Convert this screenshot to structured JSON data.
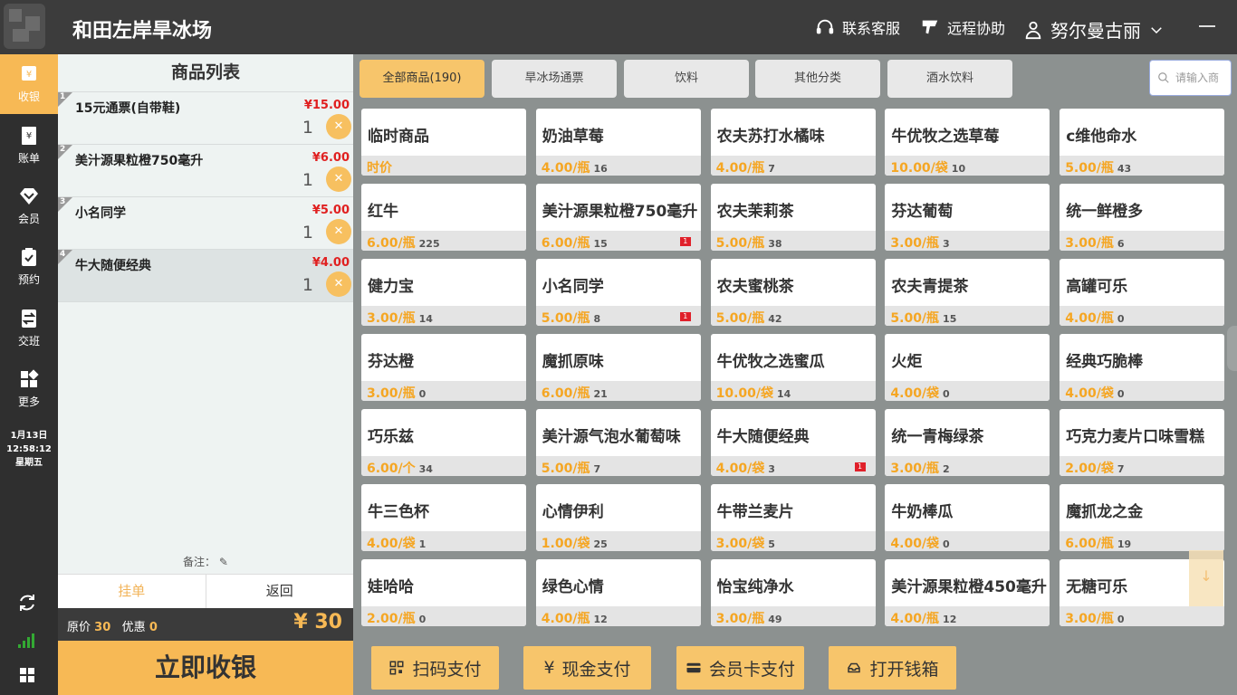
{
  "header": {
    "store_name": "和田左岸旱冰场",
    "support": "联系客服",
    "remote": "远程协助",
    "user": "努尔曼古丽"
  },
  "sidebar": {
    "items": [
      {
        "label": "收银",
        "icon": "cashier-icon"
      },
      {
        "label": "账单",
        "icon": "bill-icon"
      },
      {
        "label": "会员",
        "icon": "member-icon"
      },
      {
        "label": "预约",
        "icon": "reservation-icon"
      },
      {
        "label": "交班",
        "icon": "shift-icon"
      },
      {
        "label": "更多",
        "icon": "more-icon"
      }
    ],
    "date": "1月13日",
    "time": "12:58:12",
    "weekday": "星期五"
  },
  "cart": {
    "title": "商品列表",
    "items": [
      {
        "index": "1",
        "name": "15元通票(自带鞋)",
        "price": "¥15.00",
        "qty": "1"
      },
      {
        "index": "2",
        "name": "美汁源果粒橙750毫升",
        "price": "¥6.00",
        "qty": "1"
      },
      {
        "index": "3",
        "name": "小名同学",
        "price": "¥5.00",
        "qty": "1"
      },
      {
        "index": "4",
        "name": "牛大随便经典",
        "price": "¥4.00",
        "qty": "1"
      }
    ],
    "remark_label": "备注：",
    "hang_label": "挂单",
    "back_label": "返回",
    "orig_label": "原价",
    "orig_value": "30",
    "discount_label": "优惠",
    "discount_value": "0",
    "total": "¥ 30",
    "checkout_label": "立即收银"
  },
  "tabs": [
    {
      "label": "全部商品(190)",
      "active": true
    },
    {
      "label": "旱冰场通票",
      "active": false
    },
    {
      "label": "饮料",
      "active": false
    },
    {
      "label": "其他分类",
      "active": false
    },
    {
      "label": "酒水饮料",
      "active": false
    }
  ],
  "search": {
    "placeholder": "请输入商"
  },
  "products": [
    {
      "name": "临时商品",
      "price": "时价",
      "stock": "",
      "badge": ""
    },
    {
      "name": "奶油草莓",
      "price": "4.00/瓶",
      "stock": "16",
      "badge": ""
    },
    {
      "name": "农夫苏打水橘味",
      "price": "4.00/瓶",
      "stock": "7",
      "badge": ""
    },
    {
      "name": "牛优牧之选草莓",
      "price": "10.00/袋",
      "stock": "10",
      "badge": ""
    },
    {
      "name": "c维他命水",
      "price": "5.00/瓶",
      "stock": "43",
      "badge": ""
    },
    {
      "name": "红牛",
      "price": "6.00/瓶",
      "stock": "225",
      "badge": ""
    },
    {
      "name": "美汁源果粒橙750毫升",
      "price": "6.00/瓶",
      "stock": "15",
      "badge": "1"
    },
    {
      "name": "农夫茉莉茶",
      "price": "5.00/瓶",
      "stock": "38",
      "badge": ""
    },
    {
      "name": "芬达葡萄",
      "price": "3.00/瓶",
      "stock": "3",
      "badge": ""
    },
    {
      "name": "统一鲜橙多",
      "price": "3.00/瓶",
      "stock": "6",
      "badge": ""
    },
    {
      "name": "健力宝",
      "price": "3.00/瓶",
      "stock": "14",
      "badge": ""
    },
    {
      "name": "小名同学",
      "price": "5.00/瓶",
      "stock": "8",
      "badge": "1"
    },
    {
      "name": "农夫蜜桃茶",
      "price": "5.00/瓶",
      "stock": "42",
      "badge": ""
    },
    {
      "name": "农夫青提茶",
      "price": "5.00/瓶",
      "stock": "15",
      "badge": ""
    },
    {
      "name": "高罐可乐",
      "price": "4.00/瓶",
      "stock": "0",
      "badge": ""
    },
    {
      "name": "芬达橙",
      "price": "3.00/瓶",
      "stock": "0",
      "badge": ""
    },
    {
      "name": "魔抓原味",
      "price": "6.00/瓶",
      "stock": "21",
      "badge": ""
    },
    {
      "name": "牛优牧之选蜜瓜",
      "price": "10.00/袋",
      "stock": "14",
      "badge": ""
    },
    {
      "name": "火炬",
      "price": "4.00/袋",
      "stock": "0",
      "badge": ""
    },
    {
      "name": "经典巧脆棒",
      "price": "4.00/袋",
      "stock": "0",
      "badge": ""
    },
    {
      "name": "巧乐兹",
      "price": "6.00/个",
      "stock": "34",
      "badge": ""
    },
    {
      "name": "美汁源气泡水葡萄味",
      "price": "5.00/瓶",
      "stock": "7",
      "badge": ""
    },
    {
      "name": "牛大随便经典",
      "price": "4.00/袋",
      "stock": "3",
      "badge": "1"
    },
    {
      "name": "统一青梅绿茶",
      "price": "3.00/瓶",
      "stock": "2",
      "badge": ""
    },
    {
      "name": "巧克力麦片口味雪糕",
      "price": "2.00/袋",
      "stock": "7",
      "badge": ""
    },
    {
      "name": "牛三色杯",
      "price": "4.00/袋",
      "stock": "1",
      "badge": ""
    },
    {
      "name": "心情伊利",
      "price": "1.00/袋",
      "stock": "25",
      "badge": ""
    },
    {
      "name": "牛带兰麦片",
      "price": "3.00/袋",
      "stock": "5",
      "badge": ""
    },
    {
      "name": "牛奶棒瓜",
      "price": "4.00/袋",
      "stock": "0",
      "badge": ""
    },
    {
      "name": "魔抓龙之金",
      "price": "6.00/瓶",
      "stock": "19",
      "badge": ""
    },
    {
      "name": "娃哈哈",
      "price": "2.00/瓶",
      "stock": "0",
      "badge": ""
    },
    {
      "name": "绿色心情",
      "price": "4.00/瓶",
      "stock": "12",
      "badge": ""
    },
    {
      "name": "怡宝纯净水",
      "price": "3.00/瓶",
      "stock": "49",
      "badge": ""
    },
    {
      "name": "美汁源果粒橙450毫升",
      "price": "4.00/瓶",
      "stock": "12",
      "badge": ""
    },
    {
      "name": "无糖可乐",
      "price": "3.00/瓶",
      "stock": "0",
      "badge": ""
    }
  ],
  "payments": [
    {
      "label": "扫码支付",
      "icon": "qr-code-icon"
    },
    {
      "label": "现金支付",
      "icon": "cash-icon"
    },
    {
      "label": "会员卡支付",
      "icon": "card-icon"
    },
    {
      "label": "打开钱箱",
      "icon": "cashbox-icon"
    }
  ],
  "colors": {
    "accent": "#f7b955",
    "price": "#f5a623",
    "red": "#e02020"
  }
}
